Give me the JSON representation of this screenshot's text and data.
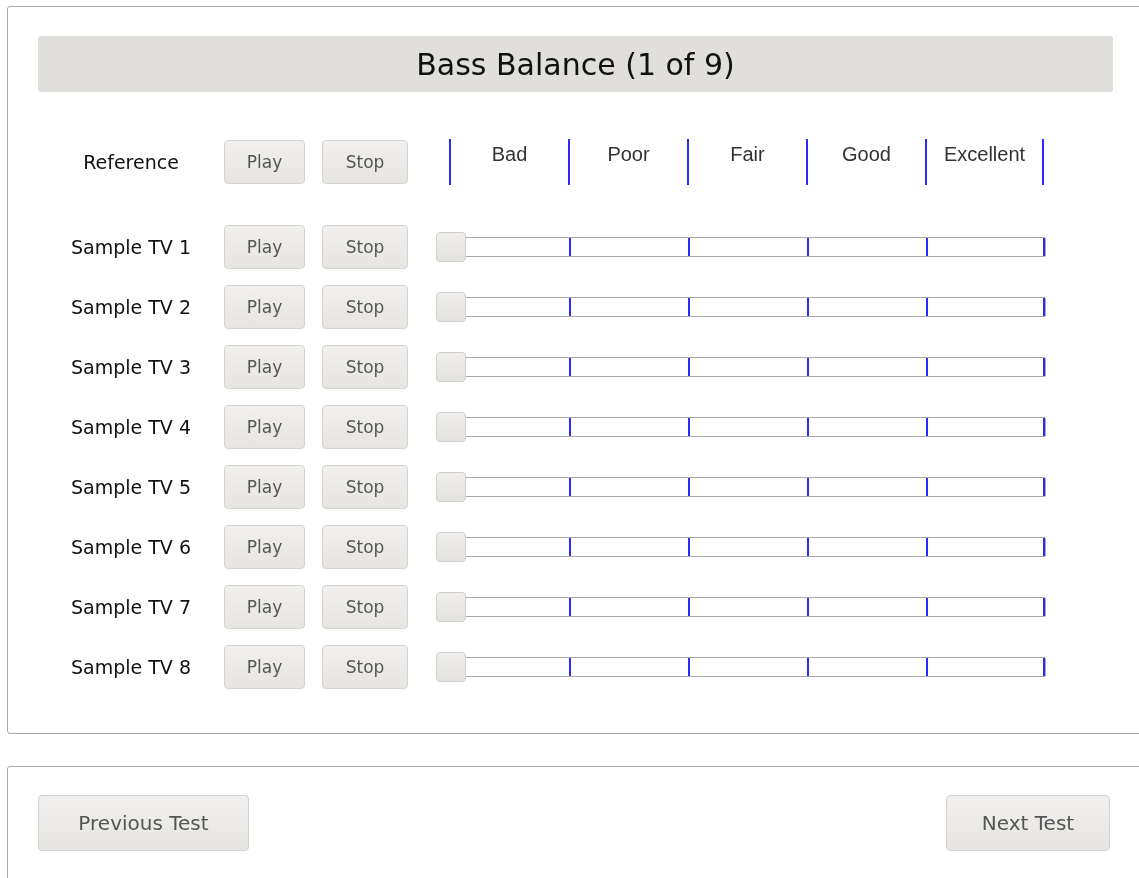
{
  "title": "Bass Balance (1 of 9)",
  "reference": {
    "label": "Reference",
    "play": "Play",
    "stop": "Stop"
  },
  "scale": [
    "Bad",
    "Poor",
    "Fair",
    "Good",
    "Excellent"
  ],
  "samples": [
    {
      "label": "Sample TV 1",
      "play": "Play",
      "stop": "Stop",
      "level": 0
    },
    {
      "label": "Sample TV 2",
      "play": "Play",
      "stop": "Stop",
      "level": 0
    },
    {
      "label": "Sample TV 3",
      "play": "Play",
      "stop": "Stop",
      "level": 0
    },
    {
      "label": "Sample TV 4",
      "play": "Play",
      "stop": "Stop",
      "level": 0
    },
    {
      "label": "Sample TV 5",
      "play": "Play",
      "stop": "Stop",
      "level": 0
    },
    {
      "label": "Sample TV 6",
      "play": "Play",
      "stop": "Stop",
      "level": 0
    },
    {
      "label": "Sample TV 7",
      "play": "Play",
      "stop": "Stop",
      "level": 0
    },
    {
      "label": "Sample TV 8",
      "play": "Play",
      "stop": "Stop",
      "level": 0
    }
  ],
  "navigation": {
    "previous": "Previous Test",
    "next": "Next Test"
  }
}
